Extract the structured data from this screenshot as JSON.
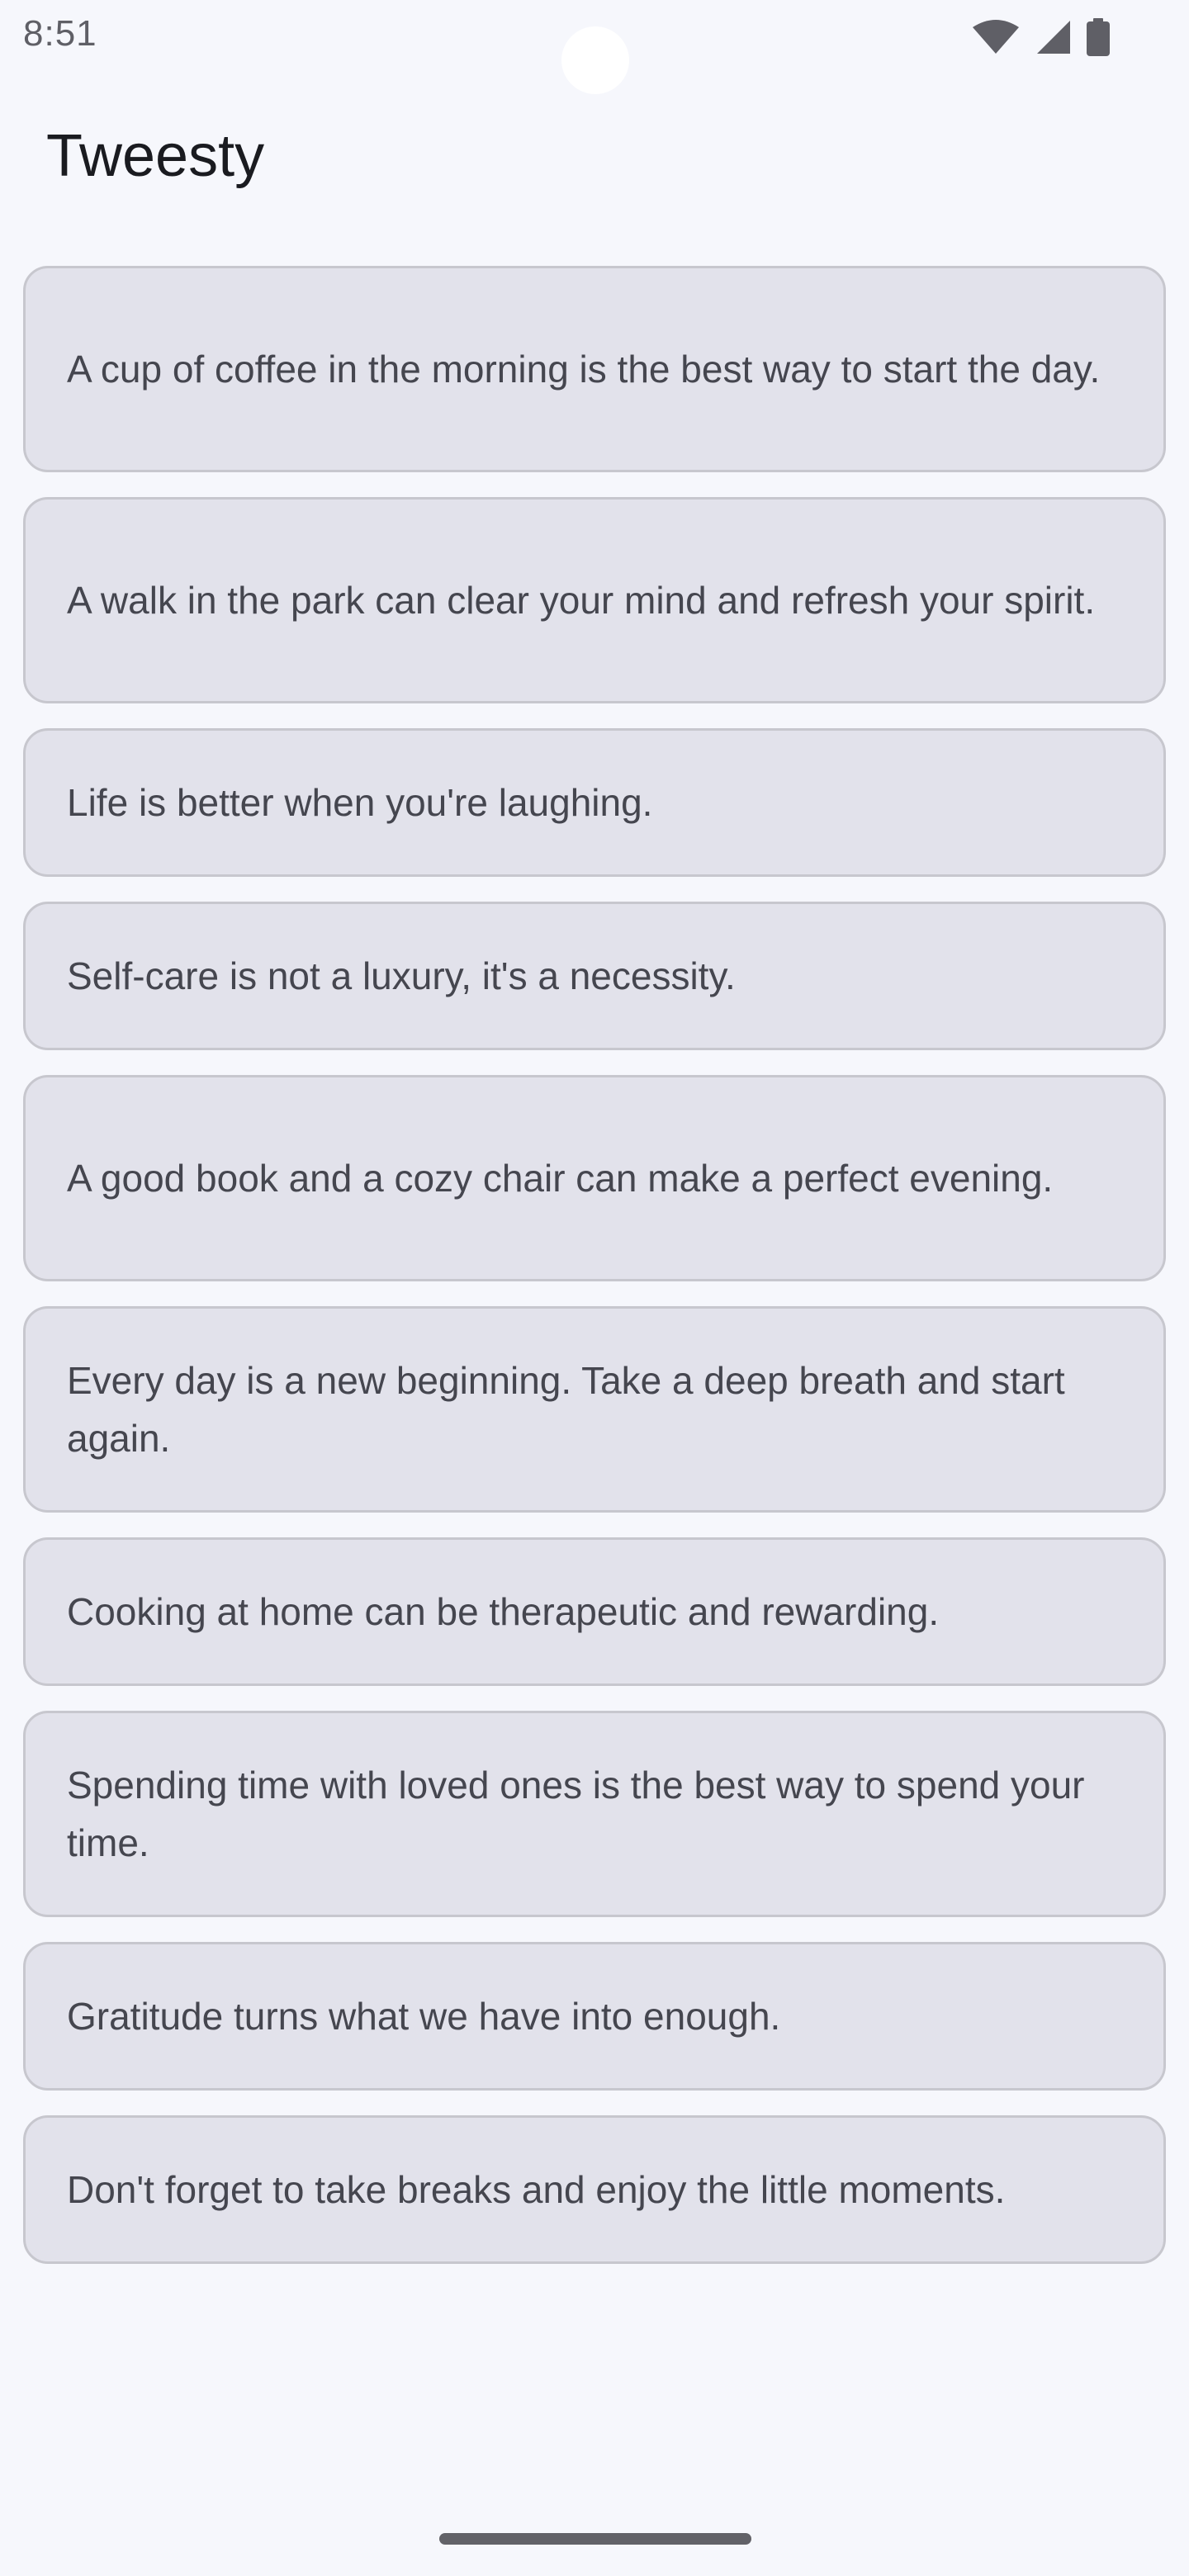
{
  "status_bar": {
    "time": "8:51",
    "icons": [
      "wifi-icon",
      "cellular-signal-icon",
      "battery-icon"
    ]
  },
  "app": {
    "title": "Tweesty"
  },
  "tweets": [
    "A cup of coffee in the morning is the best way to start the day.",
    "A walk in the park can clear your mind and refresh your spirit.",
    "Life is better when you're laughing.",
    "Self-care is not a luxury, it's a necessity.",
    "A good book and a cozy chair can make a perfect evening.",
    "Every day is a new beginning. Take a deep breath and start again.",
    "Cooking at home can be therapeutic and rewarding.",
    "Spending time with loved ones is the best way to spend your time.",
    "Gratitude turns what we have into enough.",
    "Don't forget to take breaks and enjoy the little moments."
  ],
  "colors": {
    "background": "#f6f7fc",
    "card_background": "#e2e2eb",
    "card_border": "#c7c7ce",
    "card_text": "#45464f",
    "title_text": "#1a1b20"
  }
}
